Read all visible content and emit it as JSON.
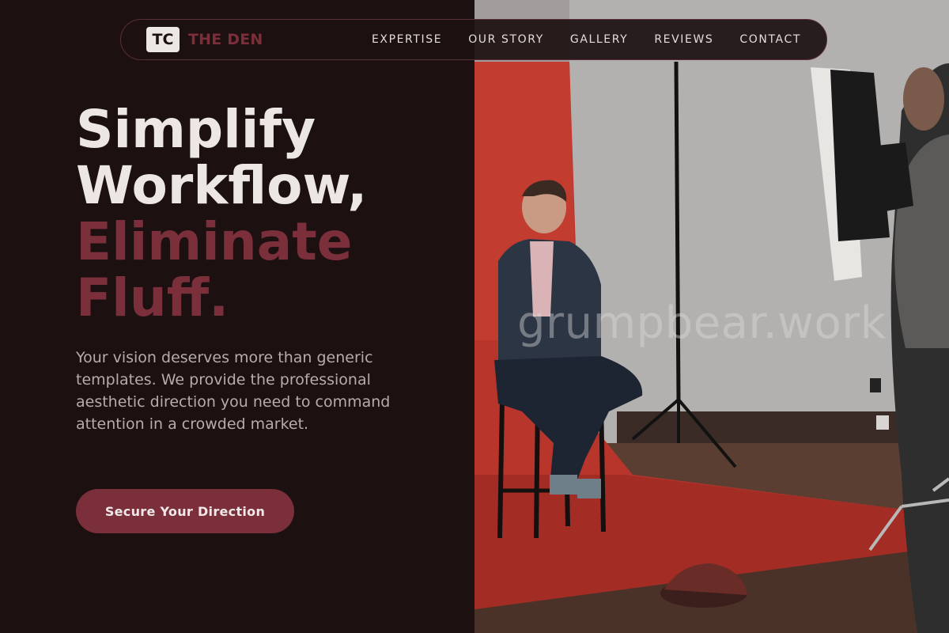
{
  "brand": {
    "badge": "TC",
    "name": "THE DEN"
  },
  "nav": {
    "links": [
      "EXPERTISE",
      "OUR STORY",
      "GALLERY",
      "REVIEWS",
      "CONTACT"
    ]
  },
  "hero": {
    "headline_light": [
      "Simplify",
      "Workflow,"
    ],
    "headline_accent": [
      "Eliminate",
      "Fluff."
    ],
    "subtext": "Your vision deserves more than generic templates. We provide the professional aesthetic direction you need to command attention in a crowded market.",
    "cta_label": "Secure Your Direction"
  },
  "watermark": "grumpbear.work",
  "colors": {
    "background": "#1c1011",
    "accent": "#7a2f3b",
    "text_light": "#ece6e4",
    "text_muted": "#b7acaa"
  }
}
